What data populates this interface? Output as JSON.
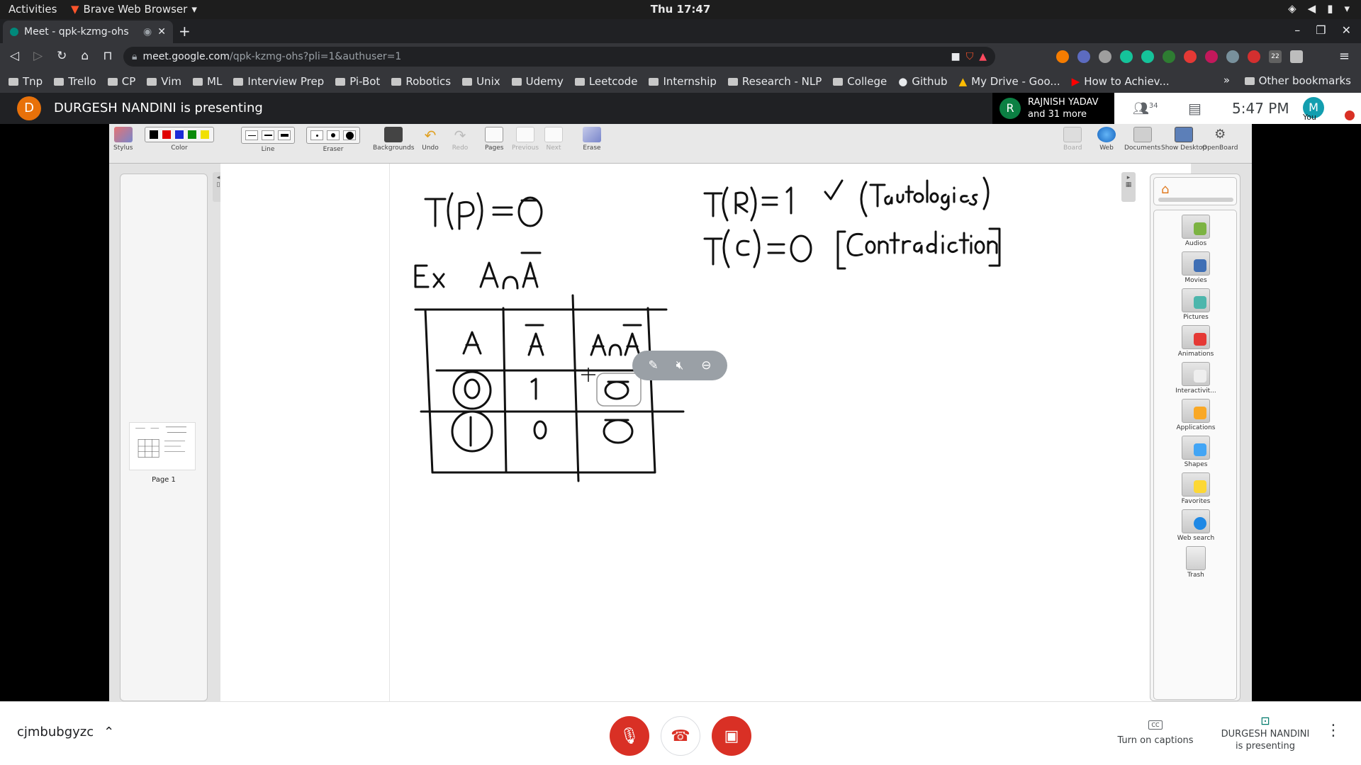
{
  "gnome": {
    "activities": "Activities",
    "app_name": "Brave Web Browser",
    "clock": "Thu 17:47"
  },
  "browser": {
    "tab_title": "Meet - qpk-kzmg-ohs",
    "url_host": "meet.google.com",
    "url_path": "/qpk-kzmg-ohs?pli=1&authuser=1",
    "bookmarks": [
      "Tnp",
      "Trello",
      "CP",
      "Vim",
      "ML",
      "Interview Prep",
      "Pi-Bot",
      "Robotics",
      "Unix",
      "Udemy",
      "Leetcode",
      "Internship",
      "Research - NLP",
      "College",
      "Github",
      "My Drive - Goo...",
      "How to Achiev..."
    ],
    "other_bookmarks": "Other bookmarks",
    "ext_badge": "22"
  },
  "meet": {
    "presenter_initial": "D",
    "presenting_text": "DURGESH NANDINI is presenting",
    "participant_initial": "R",
    "participant_name": "RAJNISH YADAV",
    "participant_more": "and 31 more",
    "people_count": "34",
    "time": "5:47  PM",
    "you_initial": "M",
    "you_label": "You",
    "meeting_code": "cjmbubgyzc",
    "captions_label": "Turn on captions",
    "present_status_line1": "DURGESH NANDINI",
    "present_status_line2": "is presenting"
  },
  "openboard": {
    "tools": {
      "stylus": "Stylus",
      "color": "Color",
      "line": "Line",
      "eraser": "Eraser",
      "backgrounds": "Backgrounds",
      "undo": "Undo",
      "redo": "Redo",
      "pages": "Pages",
      "previous": "Previous",
      "next": "Next",
      "erase": "Erase",
      "board": "Board",
      "web": "Web",
      "documents": "Documents",
      "show_desktop": "Show Desktop",
      "openboard": "OpenBoard"
    },
    "colors": [
      "#000000",
      "#e00000",
      "#1a2bd6",
      "#0a8a0a",
      "#f0e000"
    ],
    "page_label": "Page 1",
    "library": [
      "Audios",
      "Movies",
      "Pictures",
      "Animations",
      "Interactivit...",
      "Applications",
      "Shapes",
      "Favorites",
      "Web search",
      "Trash"
    ]
  }
}
